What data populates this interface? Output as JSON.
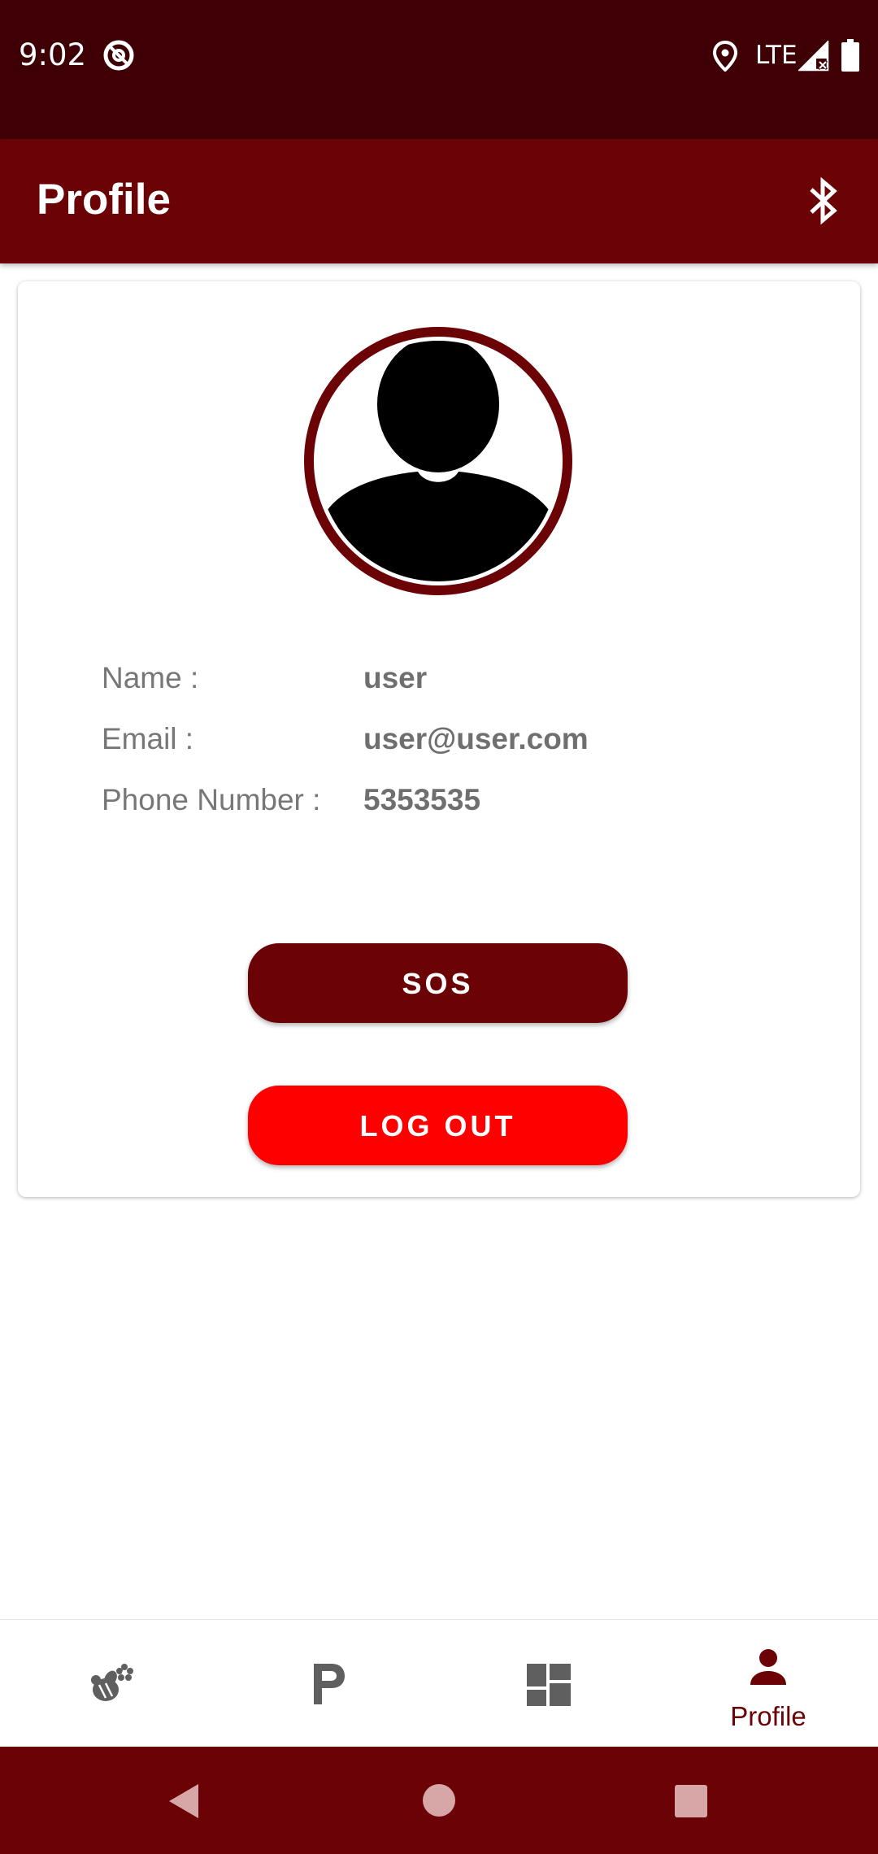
{
  "status_bar": {
    "time": "9:02",
    "network": "LTE",
    "app_icon": "at-sign-icon",
    "location_icon": "location-pin-icon",
    "signal_icon": "signal-no-data-icon",
    "battery_icon": "battery-full-icon"
  },
  "app_bar": {
    "title": "Profile",
    "action_icon": "bluetooth-icon"
  },
  "profile": {
    "avatar_icon": "user-avatar-icon",
    "fields": [
      {
        "label": "Name :",
        "value": "user"
      },
      {
        "label": "Email :",
        "value": "user@user.com"
      },
      {
        "label": "Phone Number :",
        "value": "5353535"
      }
    ],
    "sos_label": "SOS",
    "logout_label": "LOG OUT"
  },
  "bottom_nav": {
    "items": [
      {
        "icon": "bee-flower-icon",
        "label": "",
        "selected": false
      },
      {
        "icon": "parking-p-icon",
        "label": "",
        "selected": false
      },
      {
        "icon": "dashboard-icon",
        "label": "",
        "selected": false
      },
      {
        "icon": "person-icon",
        "label": "Profile",
        "selected": true
      }
    ]
  },
  "colors": {
    "status_bar": "#3f0005",
    "primary": "#6a0206",
    "logout": "#ff0000",
    "label_text": "#777777",
    "nav_inactive": "#5f5f5f"
  },
  "system_nav": {
    "back_icon": "back-triangle-icon",
    "home_icon": "home-circle-icon",
    "recents_icon": "recents-square-icon"
  }
}
